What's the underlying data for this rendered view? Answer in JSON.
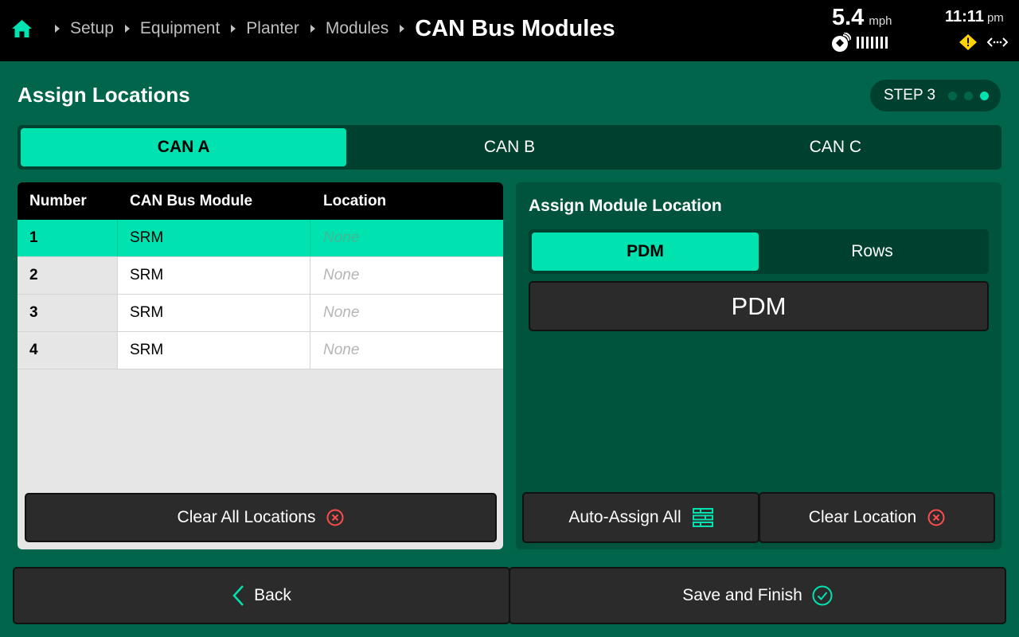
{
  "header": {
    "breadcrumbs": [
      "Setup",
      "Equipment",
      "Planter",
      "Modules"
    ],
    "current": "CAN Bus Modules",
    "speed": {
      "value": "5.4",
      "unit": "mph"
    },
    "clock": {
      "time": "11:11",
      "ampm": "pm"
    },
    "icons": [
      "home-icon",
      "gps-icon",
      "signal-icon",
      "warning-icon",
      "link-icon"
    ]
  },
  "page": {
    "title": "Assign Locations",
    "step": {
      "label": "STEP 3",
      "total": 3,
      "current": 3
    }
  },
  "can_tabs": [
    {
      "label": "CAN A",
      "active": true
    },
    {
      "label": "CAN B",
      "active": false
    },
    {
      "label": "CAN C",
      "active": false
    }
  ],
  "table": {
    "headers": [
      "Number",
      "CAN Bus Module",
      "Location"
    ],
    "rows": [
      {
        "number": "1",
        "module": "SRM",
        "location": "None",
        "selected": true
      },
      {
        "number": "2",
        "module": "SRM",
        "location": "None",
        "selected": false
      },
      {
        "number": "3",
        "module": "SRM",
        "location": "None",
        "selected": false
      },
      {
        "number": "4",
        "module": "SRM",
        "location": "None",
        "selected": false
      }
    ],
    "clear_all_label": "Clear All Locations"
  },
  "assign": {
    "title": "Assign Module Location",
    "tabs": [
      {
        "label": "PDM",
        "active": true
      },
      {
        "label": "Rows",
        "active": false
      }
    ],
    "option": "PDM",
    "auto_assign_label": "Auto-Assign All",
    "clear_location_label": "Clear Location"
  },
  "footer": {
    "back_label": "Back",
    "save_label": "Save and Finish"
  },
  "colors": {
    "background": "#00654a",
    "accent": "#00e3b0",
    "danger": "#ff4d4d",
    "warning": "#ffd400"
  }
}
